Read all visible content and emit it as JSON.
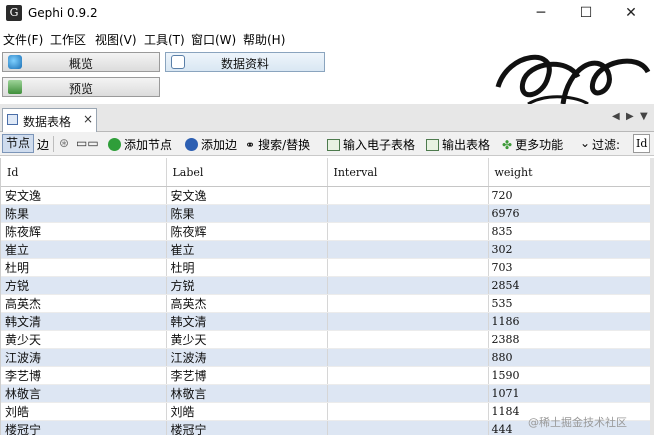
{
  "window": {
    "title": "Gephi 0.9.2",
    "controls": [
      "─",
      "☐",
      "✕"
    ]
  },
  "menu": [
    "文件(F)",
    "工作区",
    "视图(V)",
    "工具(T)",
    "窗口(W)",
    "帮助(H)"
  ],
  "nav": {
    "overview": "概览",
    "data_lab": "数据资料",
    "preview": "预览"
  },
  "tab": {
    "label": "数据表格",
    "close": "×"
  },
  "toolbar": {
    "nodes": "节点",
    "edges": "边",
    "add_node": "添加节点",
    "add_edge": "添加边",
    "search_replace": "搜索/替换",
    "import_spreadsheet": "输入电子表格",
    "export_table": "输出表格",
    "more_actions": "更多功能",
    "filter": "过滤:",
    "filter_field": "Id"
  },
  "table": {
    "columns": [
      "Id",
      "Label",
      "Interval",
      "weight"
    ],
    "rows": [
      {
        "id": "安文逸",
        "label": "安文逸",
        "interval": "",
        "weight": "720"
      },
      {
        "id": "陈果",
        "label": "陈果",
        "interval": "",
        "weight": "6976"
      },
      {
        "id": "陈夜辉",
        "label": "陈夜辉",
        "interval": "",
        "weight": "835"
      },
      {
        "id": "崔立",
        "label": "崔立",
        "interval": "",
        "weight": "302"
      },
      {
        "id": "杜明",
        "label": "杜明",
        "interval": "",
        "weight": "703"
      },
      {
        "id": "方锐",
        "label": "方锐",
        "interval": "",
        "weight": "2854"
      },
      {
        "id": "高英杰",
        "label": "高英杰",
        "interval": "",
        "weight": "535"
      },
      {
        "id": "韩文清",
        "label": "韩文清",
        "interval": "",
        "weight": "1186"
      },
      {
        "id": "黄少天",
        "label": "黄少天",
        "interval": "",
        "weight": "2388"
      },
      {
        "id": "江波涛",
        "label": "江波涛",
        "interval": "",
        "weight": "880"
      },
      {
        "id": "李艺博",
        "label": "李艺博",
        "interval": "",
        "weight": "1590"
      },
      {
        "id": "林敬言",
        "label": "林敬言",
        "interval": "",
        "weight": "1071"
      },
      {
        "id": "刘皓",
        "label": "刘皓",
        "interval": "",
        "weight": "1184"
      },
      {
        "id": "楼冠宁",
        "label": "楼冠宁",
        "interval": "",
        "weight": "444"
      }
    ]
  },
  "watermark": "@稀土掘金技术社区",
  "colors": {
    "row_alt": "#dde6f3",
    "tab_strip": "#e7e7e7",
    "toolbar_bg": "#f1f1f1"
  }
}
